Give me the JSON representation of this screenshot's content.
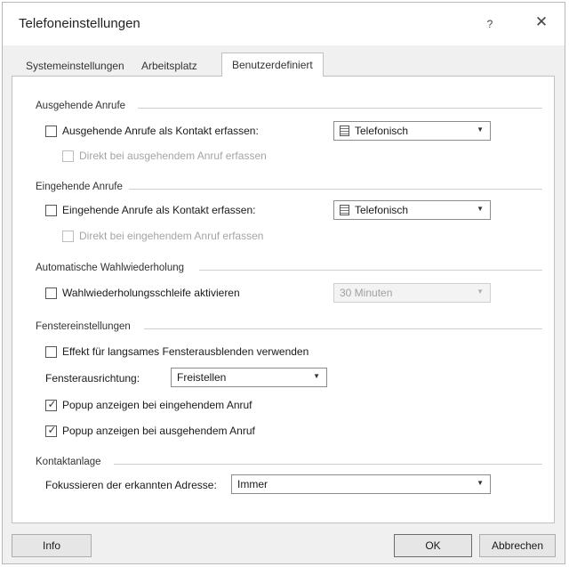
{
  "window": {
    "title": "Telefoneinstellungen",
    "help_glyph": "?",
    "close_glyph": "✕"
  },
  "tabs": [
    {
      "label": "Systemeinstellungen"
    },
    {
      "label": "Arbeitsplatz"
    },
    {
      "label": "Benutzerdefiniert"
    }
  ],
  "outgoing": {
    "heading": "Ausgehende Anrufe",
    "record_label": "Ausgehende Anrufe als Kontakt erfassen:",
    "record_checked": false,
    "mode_value": "Telefonisch",
    "direct_label": "Direkt bei ausgehendem Anruf erfassen",
    "direct_enabled": false
  },
  "incoming": {
    "heading": "Eingehende Anrufe",
    "record_label": "Eingehende Anrufe als Kontakt erfassen:",
    "record_checked": false,
    "mode_value": "Telefonisch",
    "direct_label": "Direkt bei eingehendem Anruf erfassen",
    "direct_enabled": false
  },
  "redial": {
    "heading": "Automatische Wahlwiederholung",
    "loop_label": "Wahlwiederholungsschleife aktivieren",
    "loop_checked": false,
    "interval_value": "30 Minuten",
    "interval_enabled": false
  },
  "window_settings": {
    "heading": "Fenstereinstellungen",
    "fade_label": "Effekt für langsames Fensterausblenden verwenden",
    "fade_checked": false,
    "alignment_label": "Fensterausrichtung:",
    "alignment_value": "Freistellen",
    "popup_incoming_label": "Popup anzeigen bei eingehendem Anruf",
    "popup_incoming_checked": true,
    "popup_outgoing_label": "Popup anzeigen bei ausgehendem Anruf",
    "popup_outgoing_checked": true
  },
  "contact": {
    "heading": "Kontaktanlage",
    "focus_label": "Fokussieren der erkannten Adresse:",
    "focus_value": "Immer"
  },
  "footer": {
    "info_label": "Info",
    "ok_label": "OK",
    "cancel_label": "Abbrechen"
  },
  "icons": {
    "checkmark": "✓",
    "dropdown_arrow": "▼"
  }
}
